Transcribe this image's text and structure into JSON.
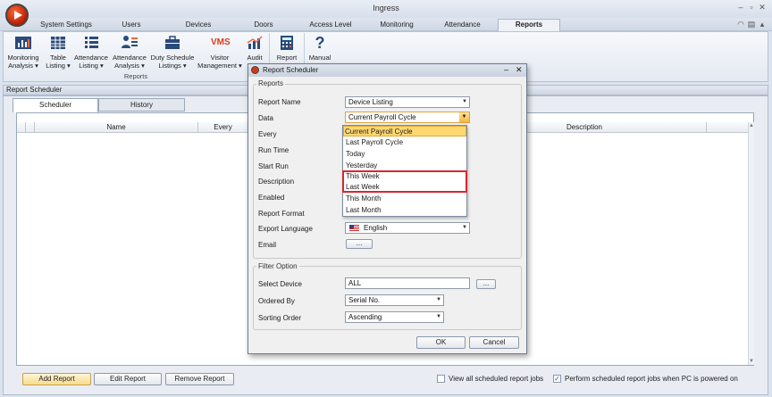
{
  "app": {
    "title": "Ingress"
  },
  "menu": {
    "tabs": [
      "System Settings",
      "Users",
      "Devices",
      "Doors",
      "Access Level",
      "Monitoring",
      "Attendance",
      "Reports"
    ],
    "active": "Reports"
  },
  "ribbon": {
    "buttons": [
      {
        "line1": "Monitoring",
        "line2": "Analysis ▾",
        "icon": "bar-chart-icon"
      },
      {
        "line1": "Table",
        "line2": "Listing ▾",
        "icon": "table-icon"
      },
      {
        "line1": "Attendance",
        "line2": "Listing ▾",
        "icon": "list-icon"
      },
      {
        "line1": "Attendance",
        "line2": "Analysis ▾",
        "icon": "analysis-icon"
      },
      {
        "line1": "Duty Schedule",
        "line2": "Listings ▾",
        "icon": "briefcase-icon"
      },
      {
        "line1": "Visitor",
        "line2": "Management ▾",
        "icon": "vms-icon",
        "badge": "VMS"
      },
      {
        "line1": "Audit",
        "line2": "",
        "icon": "audit-chart-icon"
      },
      {
        "line1": "Report",
        "line2": "",
        "icon": "report-calc-icon"
      },
      {
        "line1": "Manual",
        "line2": "",
        "icon": "question-icon"
      }
    ],
    "group_label": "Reports"
  },
  "panel": {
    "title": "Report Scheduler",
    "tabs": [
      "Scheduler",
      "History"
    ],
    "columns": [
      "Name",
      "Every",
      "Description"
    ],
    "buttons": {
      "add": "Add Report",
      "edit": "Edit Report",
      "remove": "Remove Report"
    },
    "checkboxes": {
      "view_all": {
        "label": "View all scheduled report jobs",
        "checked": false
      },
      "perform": {
        "label": "Perform scheduled report jobs when PC is powered on",
        "checked": true
      }
    }
  },
  "dialog": {
    "title": "Report Scheduler",
    "reports_legend": "Reports",
    "labels": {
      "report_name": "Report Name",
      "data": "Data",
      "every": "Every",
      "run_time": "Run Time",
      "start_run": "Start Run",
      "description": "Description",
      "enabled": "Enabled",
      "report_format": "Report Format",
      "export_language": "Export Language",
      "email": "Email"
    },
    "values": {
      "report_name": "Device Listing",
      "data": "Current Payroll Cycle",
      "export_language": "English",
      "email_button": "..."
    },
    "data_options": [
      "Current Payroll Cycle",
      "Last Payroll Cycle",
      "Today",
      "Yesterday",
      "This Week",
      "Last Week",
      "This Month",
      "Last Month"
    ],
    "filter_legend": "Filter Option",
    "filter_labels": {
      "select_device": "Select Device",
      "ordered_by": "Ordered By",
      "sorting_order": "Sorting Order"
    },
    "filter_values": {
      "select_device": "ALL",
      "ordered_by": "Serial No.",
      "sorting_order": "Ascending",
      "device_button": "..."
    },
    "buttons": {
      "ok": "OK",
      "cancel": "Cancel"
    },
    "highlight_color": "#d9262e"
  }
}
